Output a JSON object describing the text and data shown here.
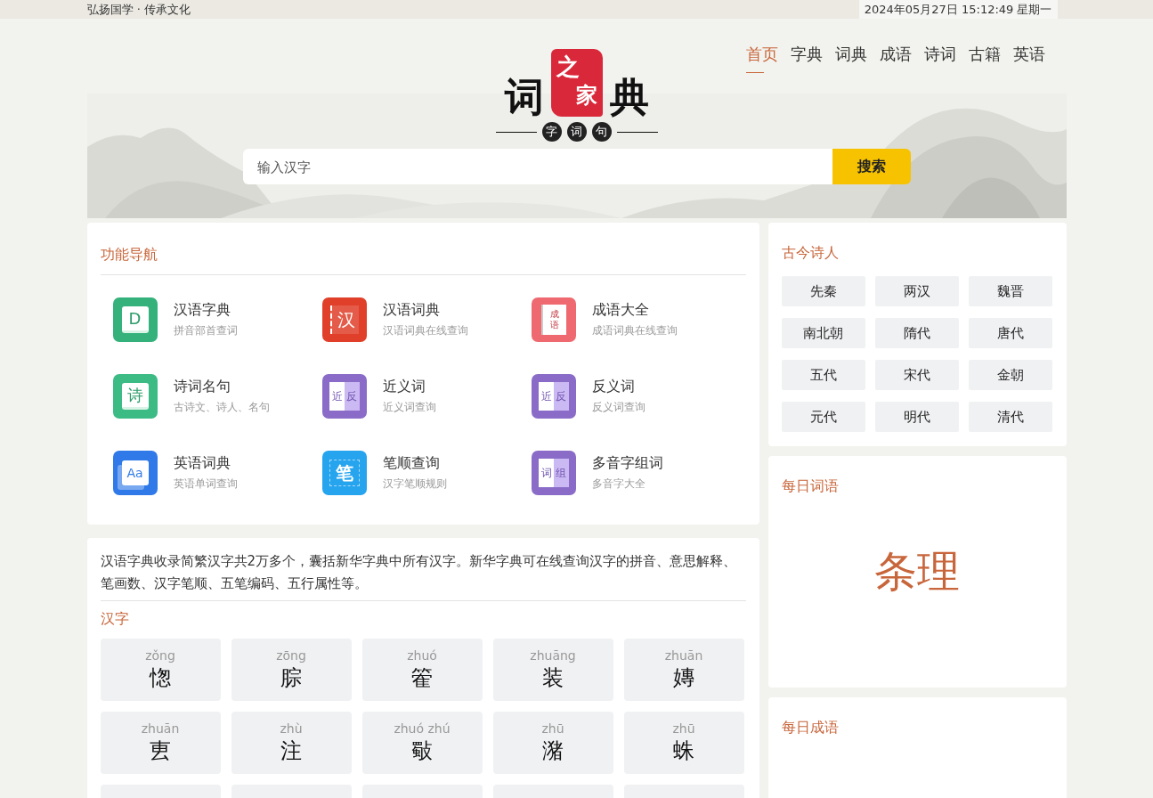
{
  "top_bar": {
    "slogan": "弘扬国学 · 传承文化",
    "datetime": "2024年05月27日 15:12:49 星期一"
  },
  "logo": {
    "left": "词",
    "seal_top": "之",
    "seal_bottom": "家",
    "right": "典",
    "badges": [
      "字",
      "词",
      "句"
    ]
  },
  "nav": [
    {
      "label": "首页",
      "selected": true
    },
    {
      "label": "字典",
      "selected": false
    },
    {
      "label": "词典",
      "selected": false
    },
    {
      "label": "成语",
      "selected": false
    },
    {
      "label": "诗词",
      "selected": false
    },
    {
      "label": "古籍",
      "selected": false
    },
    {
      "label": "英语",
      "selected": false
    }
  ],
  "search": {
    "placeholder": "输入汉字",
    "button": "搜索"
  },
  "feature_nav": {
    "title": "功能导航",
    "items": [
      {
        "title": "汉语字典",
        "subtitle": "拼音部首查词",
        "kind": "book",
        "color": "#35b27c",
        "icon_text": [
          "D"
        ]
      },
      {
        "title": "汉语词典",
        "subtitle": "汉语词典在线查询",
        "kind": "tab",
        "color": "#e0402a",
        "icon_text": [
          "汉"
        ]
      },
      {
        "title": "成语大全",
        "subtitle": "成语词典在线查询",
        "kind": "notebook",
        "color": "#ee6a70",
        "icon_text": [
          "成",
          "语"
        ]
      },
      {
        "title": "诗词名句",
        "subtitle": "古诗文、诗人、名句",
        "kind": "book",
        "color": "#3dbb84",
        "icon_text": [
          "诗"
        ]
      },
      {
        "title": "近义词",
        "subtitle": "近义词查询",
        "kind": "split",
        "color": "#8a6cc8",
        "icon_text": [
          "近",
          "反"
        ]
      },
      {
        "title": "反义词",
        "subtitle": "反义词查询",
        "kind": "split",
        "color": "#8a6cc8",
        "icon_text": [
          "近",
          "反"
        ]
      },
      {
        "title": "英语词典",
        "subtitle": "英语单词查询",
        "kind": "cards",
        "color": "#2f7ae8",
        "icon_text": [
          "Aa"
        ]
      },
      {
        "title": "笔顺查询",
        "subtitle": "汉字笔顺规则",
        "kind": "brush",
        "color": "#26a4ee",
        "icon_text": [
          "笔"
        ]
      },
      {
        "title": "多音字组词",
        "subtitle": "多音字大全",
        "kind": "split",
        "color": "#8a6cc8",
        "icon_text": [
          "词",
          "组"
        ]
      }
    ]
  },
  "intro": "汉语字典收录简繁汉字共2万多个，囊括新华字典中所有汉字。新华字典可在线查询汉字的拼音、意思解释、笔画数、汉字笔顺、五笔编码、五行属性等。",
  "hanzi": {
    "title": "汉字",
    "items": [
      {
        "pinyin": "zǒng",
        "char": "愡"
      },
      {
        "pinyin": "zōng",
        "char": "腙"
      },
      {
        "pinyin": "zhuó",
        "char": "篧"
      },
      {
        "pinyin": "zhuāng",
        "char": "装"
      },
      {
        "pinyin": "zhuān",
        "char": "嫥"
      },
      {
        "pinyin": "zhuān",
        "char": "叀"
      },
      {
        "pinyin": "zhù",
        "char": "注"
      },
      {
        "pinyin": "zhuó zhú",
        "char": "斀"
      },
      {
        "pinyin": "zhū",
        "char": "潴"
      },
      {
        "pinyin": "zhū",
        "char": "蛛"
      }
    ]
  },
  "poets": {
    "title": "古今诗人",
    "eras": [
      "先秦",
      "两汉",
      "魏晋",
      "南北朝",
      "隋代",
      "唐代",
      "五代",
      "宋代",
      "金朝",
      "元代",
      "明代",
      "清代"
    ]
  },
  "daily_word": {
    "title": "每日词语",
    "word": "条理"
  },
  "daily_idiom": {
    "title": "每日成语"
  }
}
